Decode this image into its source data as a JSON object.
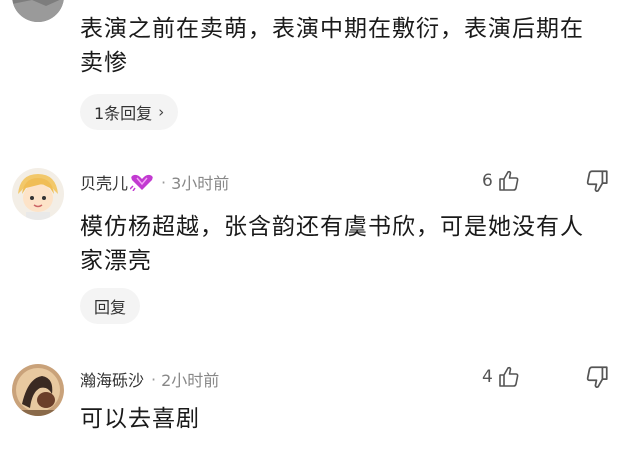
{
  "comment1": {
    "text_line1": "表演之前在卖萌，表演中期在敷衍，表演后期在",
    "text_line2": "卖惨",
    "reply_button": "1条回复",
    "reply_chevron": "›"
  },
  "comment2": {
    "username": "贝壳儿",
    "badge_icon": "heart-gem-icon",
    "separator": "·",
    "time": "3小时前",
    "likes": "6",
    "text_line1": "模仿杨超越，张含韵还有虞书欣，可是她没有人",
    "text_line2": "家漂亮",
    "reply_button": "回复"
  },
  "comment3": {
    "username": "瀚海砾沙",
    "separator": "·",
    "time": "2小时前",
    "likes": "4",
    "text_line1": "可以去喜剧"
  },
  "colors": {
    "text": "#1a1a1a",
    "meta": "#888888",
    "button_bg": "#f4f4f4",
    "badge": "#c23ad1"
  }
}
